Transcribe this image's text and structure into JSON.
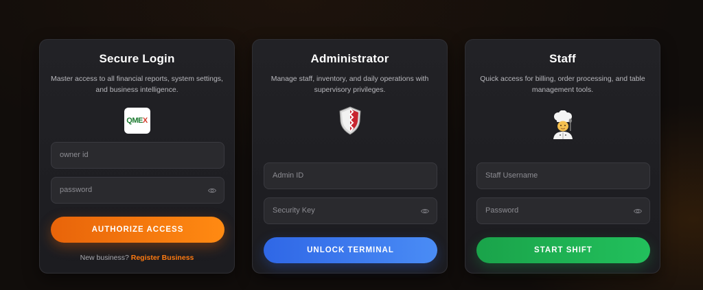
{
  "cards": [
    {
      "title": "Secure Login",
      "description": "Master access to all financial reports, system settings, and business intelligence.",
      "logo_text_main": "QME",
      "logo_text_accent": "X",
      "fields": [
        {
          "placeholder": "owner id"
        },
        {
          "placeholder": "password"
        }
      ],
      "action_label": "AUTHORIZE ACCESS",
      "footer_text": "New business?",
      "footer_link": "Register Business",
      "accent": "#ff7a10"
    },
    {
      "title": "Administrator",
      "description": "Manage staff, inventory, and daily operations with supervisory privileges.",
      "icon": "shield-icon",
      "fields": [
        {
          "placeholder": "Admin ID"
        },
        {
          "placeholder": "Security Key"
        }
      ],
      "action_label": "UNLOCK TERMINAL",
      "accent": "#3a78ee"
    },
    {
      "title": "Staff",
      "description": "Quick access for billing, order processing, and table management tools.",
      "icon": "chef-icon",
      "fields": [
        {
          "placeholder": "Staff Username"
        },
        {
          "placeholder": "Password"
        }
      ],
      "action_label": "START SHIFT",
      "accent": "#1fb254"
    }
  ]
}
